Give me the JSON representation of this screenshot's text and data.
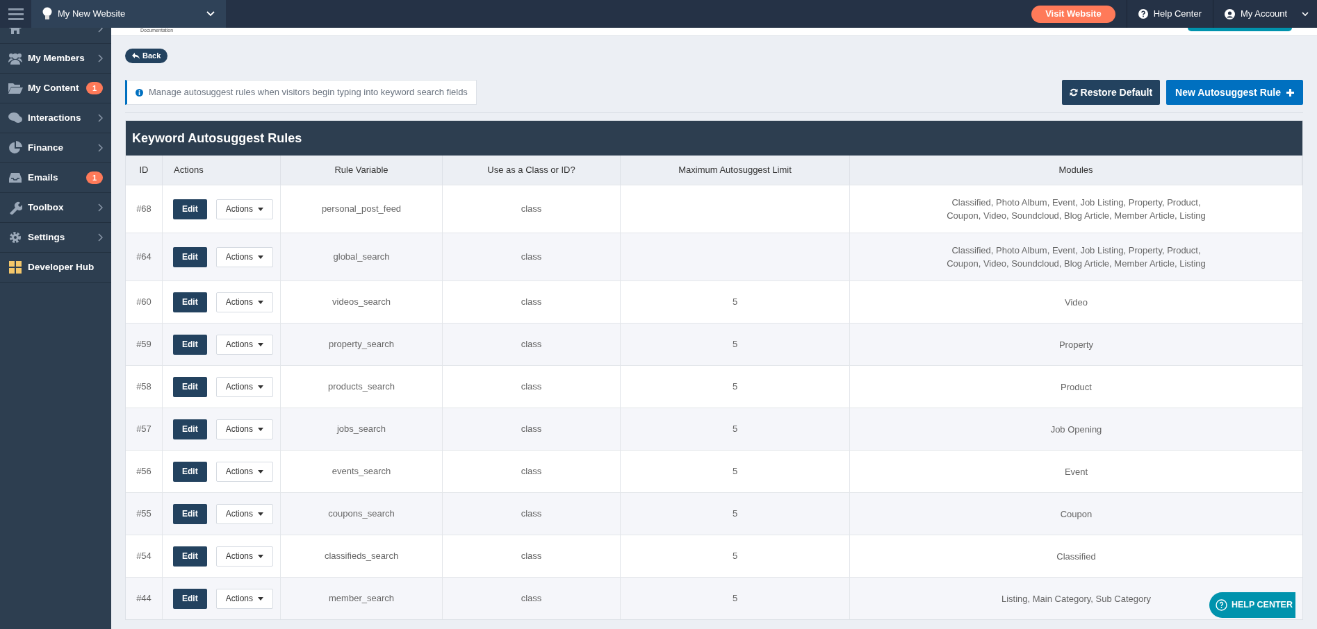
{
  "header": {
    "site": "My New Website",
    "visit_button": "Visit Website",
    "help_link": "Help Center",
    "account": "My Account"
  },
  "sidebar": {
    "items": [
      {
        "expandable": true
      },
      {
        "label": "My Members",
        "expandable": true
      },
      {
        "label": "My Content",
        "badge": "1",
        "expandable": false
      },
      {
        "label": "Interactions",
        "expandable": true
      },
      {
        "label": "Finance",
        "expandable": true
      },
      {
        "label": "Emails",
        "badge": "1",
        "expandable": false
      },
      {
        "label": "Toolbox",
        "expandable": true
      },
      {
        "label": "Settings",
        "expandable": true
      },
      {
        "label": "Developer Hub",
        "expandable": false
      }
    ]
  },
  "top_strip": {
    "text": "Documentation"
  },
  "back_button": "Back",
  "info": "Manage autosuggest rules when visitors begin typing into keyword search fields",
  "buttons": {
    "restore": "Restore Default",
    "new_rule": "New Autosuggest Rule"
  },
  "table": {
    "title": "Keyword Autosuggest Rules",
    "columns": [
      "ID",
      "Actions",
      "Rule Variable",
      "Use as a Class or ID?",
      "Maximum Autosuggest Limit",
      "Modules"
    ],
    "rows": [
      {
        "id": "#68",
        "edit": "Edit",
        "actions": "Actions",
        "variable": "personal_post_feed",
        "use": "class",
        "modules": "Classified, Photo Album, Event, Job Listing, Property, Product, Coupon, Video, Soundcloud, Blog Article, Member Article, Listing"
      },
      {
        "id": "#64",
        "edit": "Edit",
        "actions": "Actions",
        "variable": "global_search",
        "use": "class",
        "modules": "Classified, Photo Album, Event, Job Listing, Property, Product, Coupon, Video, Soundcloud, Blog Article, Member Article, Listing"
      },
      {
        "id": "#60",
        "edit": "Edit",
        "actions": "Actions",
        "variable": "videos_search",
        "use": "class",
        "limit": "5",
        "modules": "Video"
      },
      {
        "id": "#59",
        "edit": "Edit",
        "actions": "Actions",
        "variable": "property_search",
        "use": "class",
        "limit": "5",
        "modules": "Property"
      },
      {
        "id": "#58",
        "edit": "Edit",
        "actions": "Actions",
        "variable": "products_search",
        "use": "class",
        "limit": "5",
        "modules": "Product"
      },
      {
        "id": "#57",
        "edit": "Edit",
        "actions": "Actions",
        "variable": "jobs_search",
        "use": "class",
        "limit": "5",
        "modules": "Job Opening"
      },
      {
        "id": "#56",
        "edit": "Edit",
        "actions": "Actions",
        "variable": "events_search",
        "use": "class",
        "limit": "5",
        "modules": "Event"
      },
      {
        "id": "#55",
        "edit": "Edit",
        "actions": "Actions",
        "variable": "coupons_search",
        "use": "class",
        "limit": "5",
        "modules": "Coupon"
      },
      {
        "id": "#54",
        "edit": "Edit",
        "actions": "Actions",
        "variable": "classifieds_search",
        "use": "class",
        "limit": "5",
        "modules": "Classified"
      },
      {
        "id": "#44",
        "edit": "Edit",
        "actions": "Actions",
        "variable": "member_search",
        "use": "class",
        "limit": "5",
        "modules": "Listing, Main Category, Sub Category"
      }
    ]
  },
  "help_center_button": "HELP CENTER"
}
